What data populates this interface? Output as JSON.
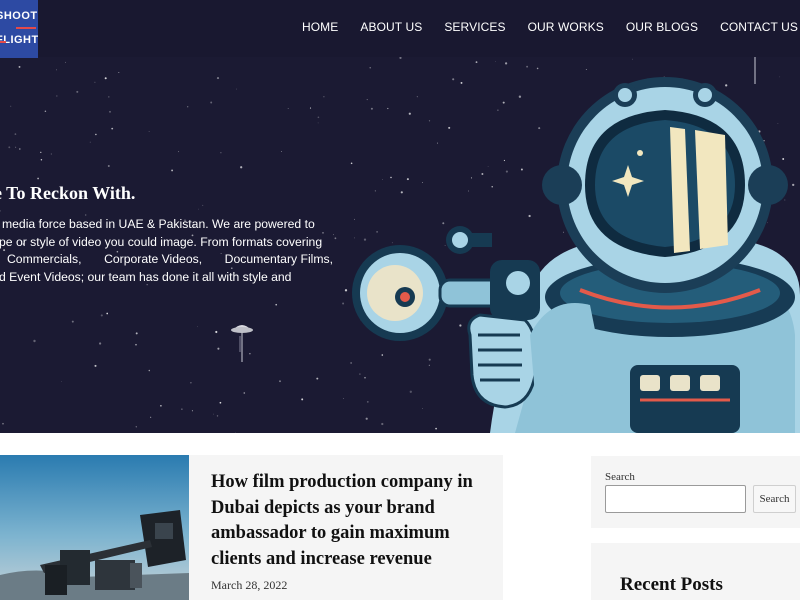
{
  "logo": {
    "line1": "SHOOT",
    "line2": "FLIGHT"
  },
  "nav": {
    "items": [
      "HOME",
      "ABOUT US",
      "SERVICES",
      "OUR WORKS",
      "OUR BLOGS",
      "CONTACT US"
    ]
  },
  "hero": {
    "heading": "e To Reckon With.",
    "lines": [
      [
        "media force based in UAE & Pakistan. We are powered to"
      ],
      [
        "pe or style of video you could image. From formats covering"
      ],
      [
        "Commercials,",
        "Corporate Videos,",
        "Documentary Films,"
      ],
      [
        "d Event Videos; our team has done it all with style and"
      ]
    ]
  },
  "post": {
    "title": "How film production company in Dubai depicts as your brand ambassador to gain maximum clients and increase revenue",
    "date": "March 28, 2022"
  },
  "sidebar": {
    "search_label": "Search",
    "search_value": "",
    "search_button": "Search",
    "recent_title": "Recent Posts"
  },
  "colors": {
    "hero_bg": "#1b1a33",
    "nav_bg": "#191830",
    "logo_bg": "#2d4aa3",
    "card_bg": "#f5f5f5"
  }
}
